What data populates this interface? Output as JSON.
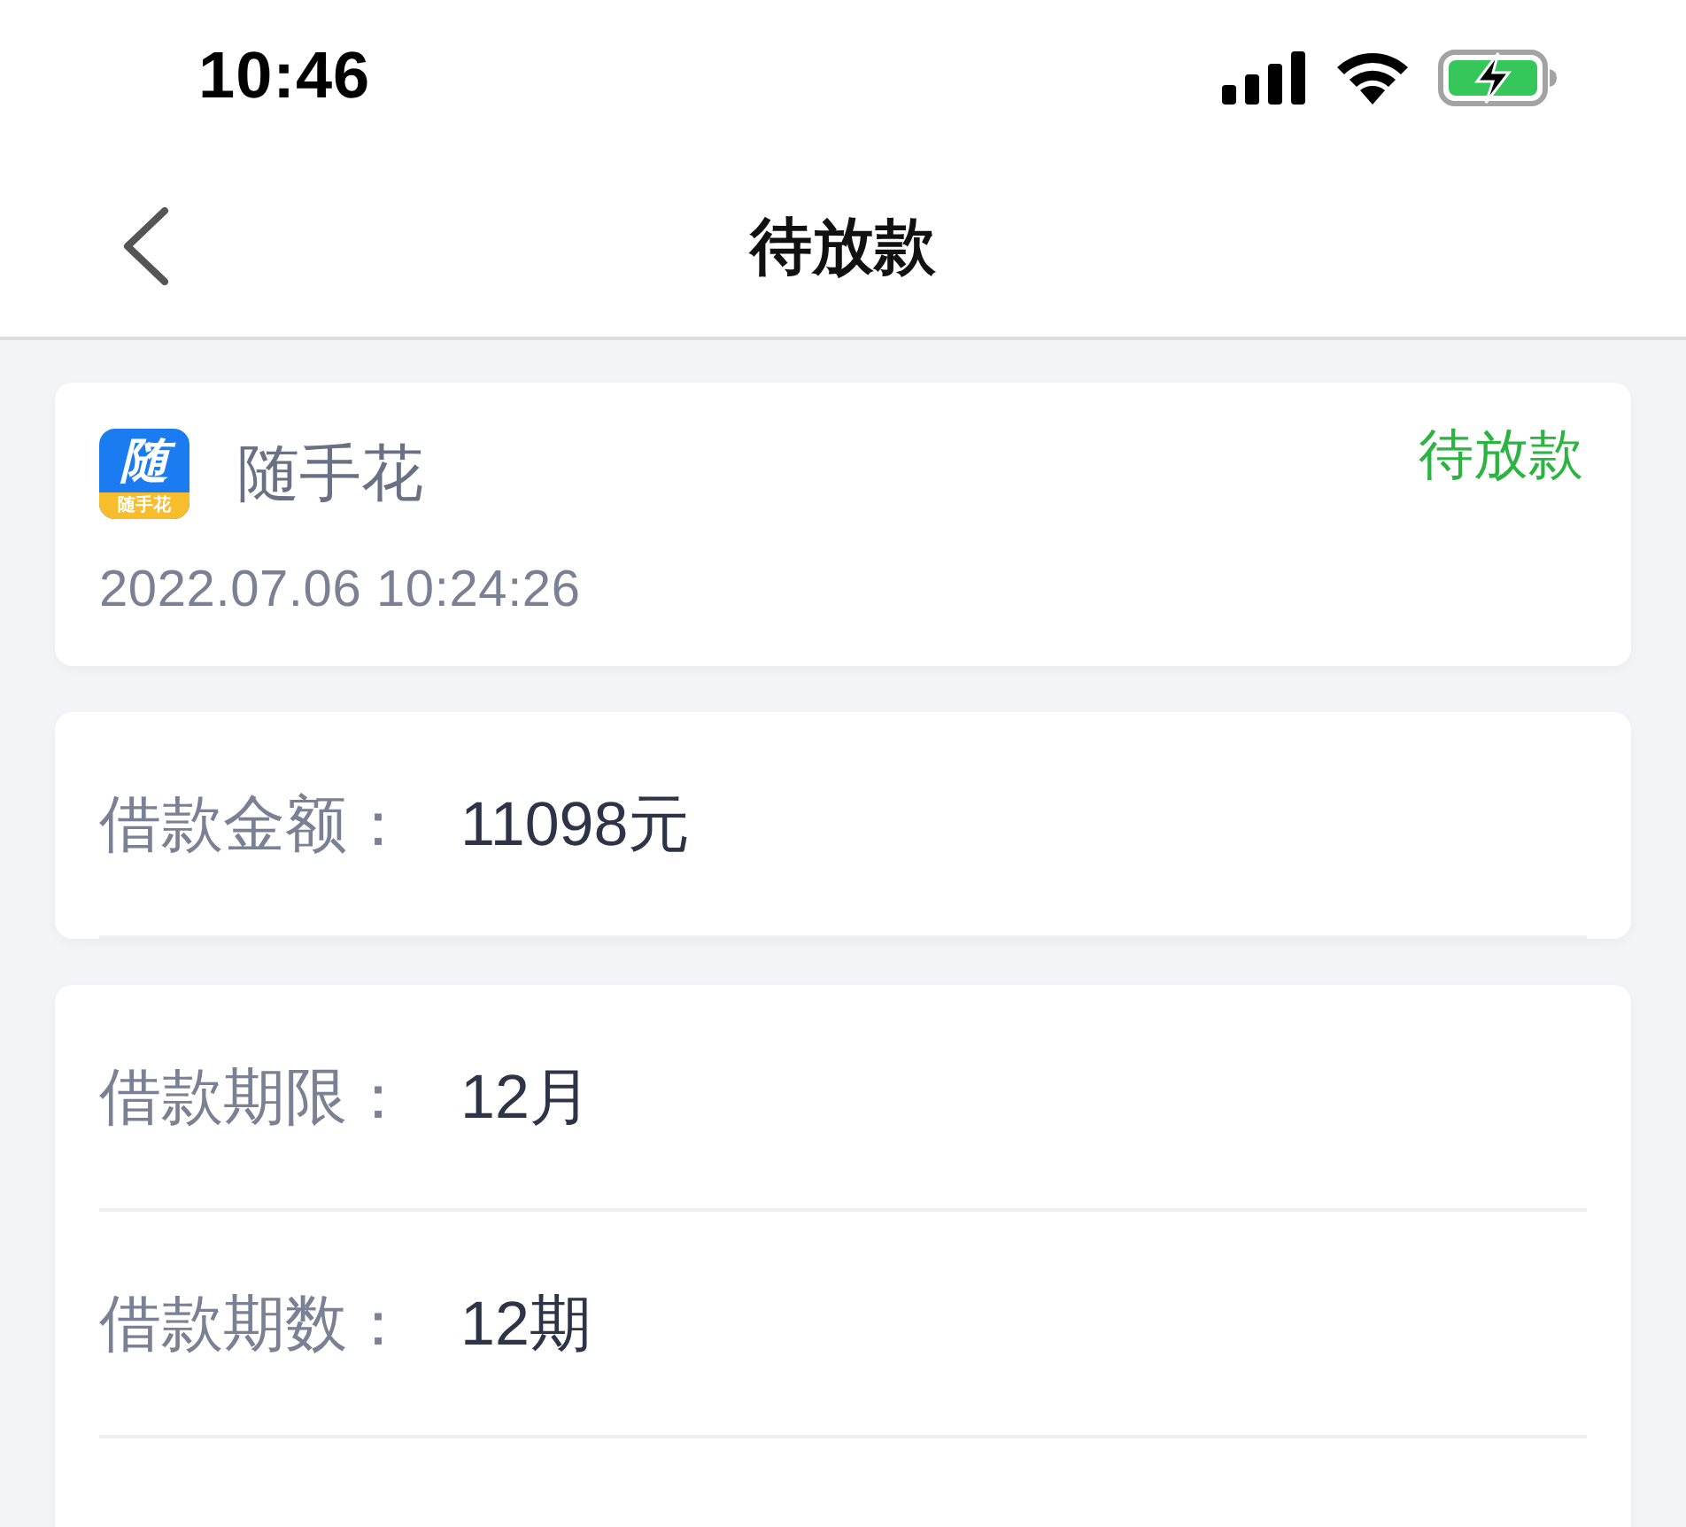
{
  "status_bar": {
    "time": "10:46"
  },
  "nav_bar": {
    "title": "待放款"
  },
  "order": {
    "app_logo": {
      "glyph": "随",
      "caption": "随手花"
    },
    "app_name": "随手花",
    "status": {
      "text": "待放款",
      "kind": "pending"
    },
    "date": "2022.07.06 10:24:26"
  },
  "amount_card": {
    "rows": [
      {
        "label": "借款金额：",
        "value": "11098元"
      }
    ]
  },
  "terms_card": {
    "rows": [
      {
        "label": "借款期限：",
        "value": "12月"
      },
      {
        "label": "借款期数：",
        "value": "12期"
      }
    ]
  }
}
